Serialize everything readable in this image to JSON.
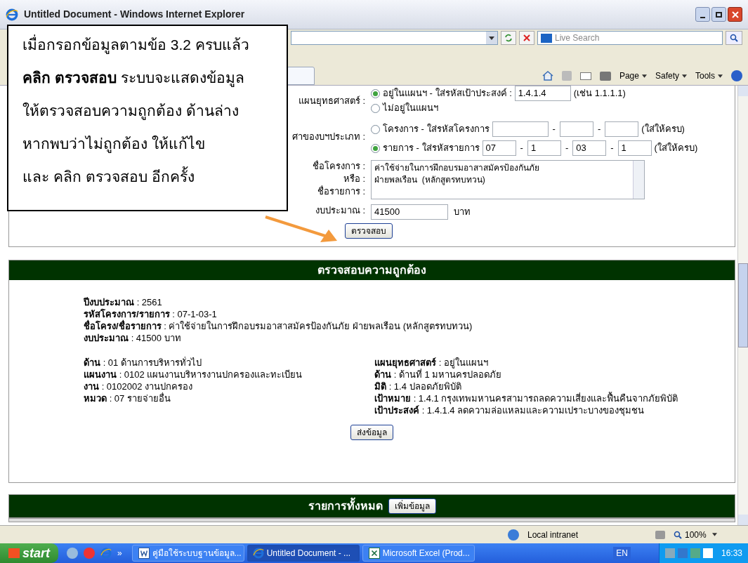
{
  "window": {
    "title": "Untitled Document - Windows Internet Explorer"
  },
  "toolbar": {
    "search_placeholder": "Live Search",
    "commands": [
      "Page",
      "Safety",
      "Tools"
    ]
  },
  "callout": {
    "lines": [
      "เมื่อกรอกข้อมูลตามข้อ 3.2 ครบแล้ว",
      "**คลิก ตรวจสอบ** ระบบจะแสดงข้อมูล",
      "ให้ตรวจสอบความถูกต้อง ด้านล่าง",
      "หากพบว่าไม่ถูกต้อง ให้แก้ไข",
      "และ คลิก ตรวจสอบ อีกครั้ง"
    ]
  },
  "form": {
    "strategy": {
      "label": "แผนยุทธศาสตร์ :",
      "options": [
        {
          "label": "อยู่ในแผนฯ - ใส่รหัสเป้าประสงค์ :",
          "selected": true,
          "value": "1.4.1.4",
          "hint": "(เช่น 1.1.1.1)"
        },
        {
          "label": "ไม่อยู่ในแผนฯ",
          "selected": false
        }
      ]
    },
    "type": {
      "label": "ศาของบฯประเภท :",
      "options": [
        {
          "label": "โครงการ - ใส่รหัสโครงการ",
          "selected": false,
          "separator": "-",
          "codes": [
            {
              "kind": "blank"
            },
            {
              "kind": "blank"
            },
            {
              "kind": "blank"
            }
          ],
          "hint": "(ใส่ให้ครบ)"
        },
        {
          "label": "รายการ - ใส่รหัสรายการ",
          "selected": true,
          "separator": "-",
          "codes": [
            {
              "kind": "text",
              "value": "07"
            },
            {
              "kind": "text",
              "value": "1"
            },
            {
              "kind": "text",
              "value": "03"
            },
            {
              "kind": "text",
              "value": "1"
            }
          ],
          "hint": "(ใส่ให้ครบ)"
        }
      ]
    },
    "name": {
      "labels": [
        "ชื่อโครงการ :",
        "หรือ :",
        "ชื่อรายการ :"
      ],
      "lines": [
        "ค่าใช้จ่ายในการฝึกอบรมอาสาสมัครป้องกันภัย",
        "ฝ่ายพลเรือน  (หลักสูตรทบทวน)"
      ]
    },
    "budget": {
      "label": "งบประมาณ :",
      "value": "41500",
      "unit": "บาท"
    },
    "button": "ตรวจสอบ"
  },
  "verify": {
    "title": "ตรวจสอบความถูกต้อง",
    "summary": [
      {
        "label": "ปีงบประมาณ",
        "value": " : 2561"
      },
      {
        "label": "รหัสโครงการ/รายการ",
        "value": " : 07-1-03-1"
      },
      {
        "label": "ชื่อโครง/ชื่อรายการ",
        "value": " : ค่าใช้จ่ายในการฝึกอบรมอาสาสมัครป้องกันภัย ฝ่ายพลเรือน (หลักสูตรทบทวน)"
      },
      {
        "label": "งบประมาณ",
        "value": " : 41500 บาท"
      }
    ],
    "left": [
      {
        "label": "ด้าน",
        "value": " : 01 ด้านการบริหารทั่วไป"
      },
      {
        "label": "แผนงาน",
        "value": " : 0102 แผนงานบริหารงานปกครองและทะเบียน"
      },
      {
        "label": "งาน",
        "value": " : 0102002 งานปกครอง"
      },
      {
        "label": "หมวด",
        "value": " : 07 รายจ่ายอื่น"
      }
    ],
    "right": [
      {
        "label": "แผนยุทธศาสตร์",
        "value": " : อยู่ในแผนฯ"
      },
      {
        "label": "ด้าน",
        "value": " : ด้านที่ 1 มหานครปลอดภัย"
      },
      {
        "label": "มิติ",
        "value": " : 1.4 ปลอดภัยพิบัติ"
      },
      {
        "label": "เป้าหมาย",
        "value": " : 1.4.1 กรุงเทพมหานครสามารถลดความเสี่ยงและฟื้นคืนจากภัยพิบัติ"
      },
      {
        "label": "เป้าประสงค์",
        "value": " : 1.4.1.4 ลดความล่อแหลมและความเปราะบางของชุมชน"
      }
    ],
    "button": "ส่งข้อมูล"
  },
  "all_items": {
    "title": "รายการทั้งหมด",
    "button": "เพิ่มข้อมูล"
  },
  "status_bar": {
    "zone": "Local intranet",
    "zoom": "100%"
  },
  "taskbar": {
    "start": "start",
    "more": "»",
    "tasks": [
      {
        "label": "คู่มือใช้ระบบฐานข้อมูล...",
        "kind": "word",
        "selected": false
      },
      {
        "label": "Untitled Document - ...",
        "kind": "ie",
        "selected": true
      },
      {
        "label": "Microsoft Excel (Prod...",
        "kind": "excel",
        "selected": false
      }
    ],
    "language": "EN",
    "clock": "16:33"
  }
}
